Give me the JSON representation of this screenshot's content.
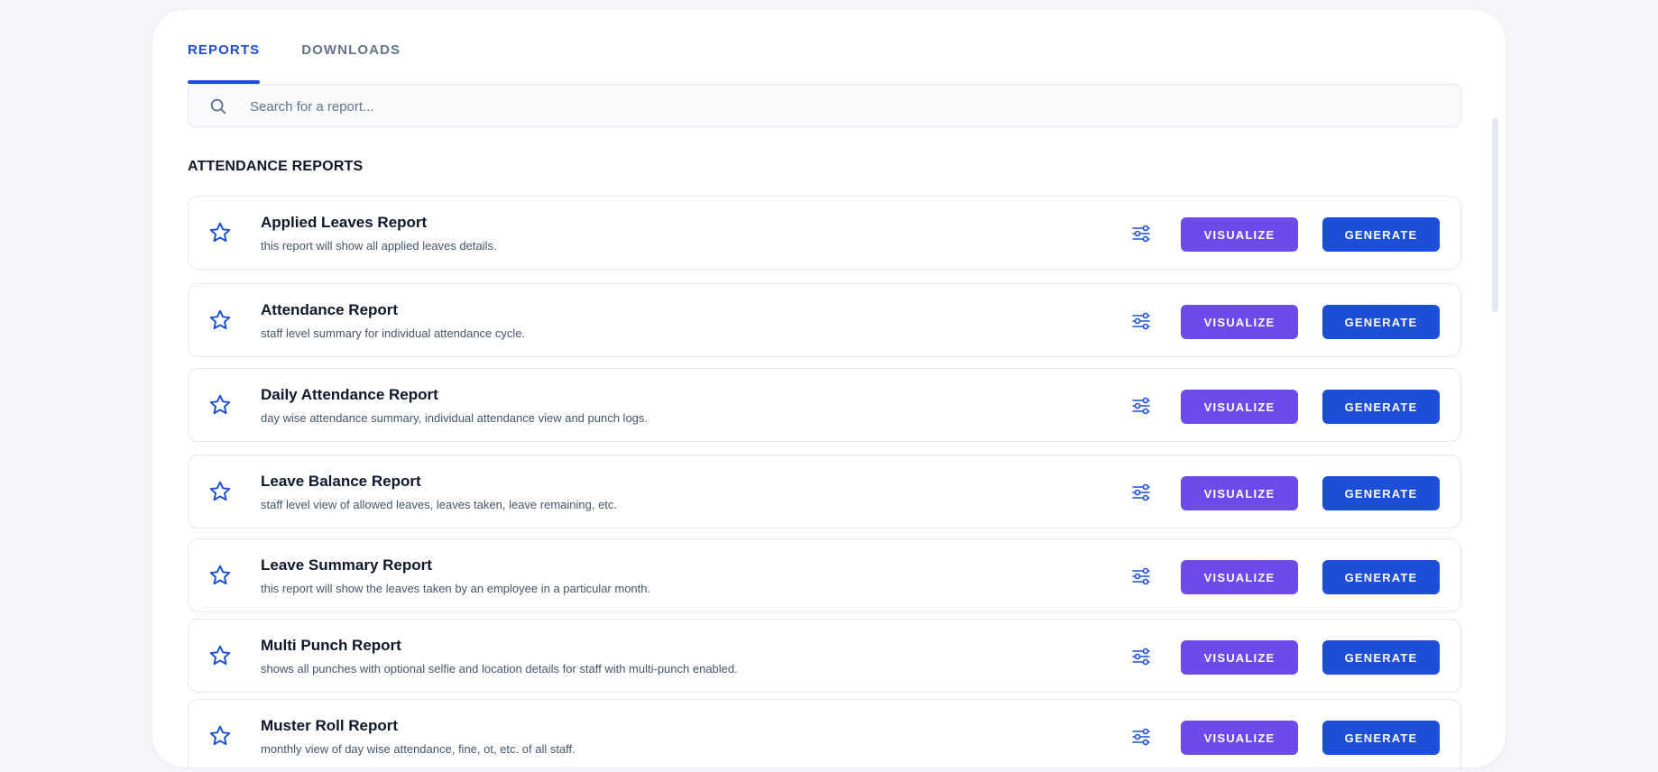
{
  "tabs": [
    {
      "label": "REPORTS",
      "active": true
    },
    {
      "label": "DOWNLOADS",
      "active": false
    }
  ],
  "search": {
    "placeholder": "Search for a report...",
    "value": ""
  },
  "section": {
    "title": "ATTENDANCE REPORTS"
  },
  "colors": {
    "accent": "#1d4ed8",
    "visualize": "#6d4aea",
    "generate": "#1d4ed8"
  },
  "reports": [
    {
      "title": "Applied Leaves Report",
      "description": "this report will show all applied leaves details.",
      "visualize_label": "VISUALIZE",
      "generate_label": "GENERATE"
    },
    {
      "title": "Attendance Report",
      "description": "staff level summary for individual attendance cycle.",
      "visualize_label": "VISUALIZE",
      "generate_label": "GENERATE"
    },
    {
      "title": "Daily Attendance Report",
      "description": "day wise attendance summary, individual attendance view and punch logs.",
      "visualize_label": "VISUALIZE",
      "generate_label": "GENERATE"
    },
    {
      "title": "Leave Balance Report",
      "description": "staff level view of allowed leaves, leaves taken, leave remaining, etc.",
      "visualize_label": "VISUALIZE",
      "generate_label": "GENERATE"
    },
    {
      "title": "Leave Summary Report",
      "description": "this report will show the leaves taken by an employee in a particular month.",
      "visualize_label": "VISUALIZE",
      "generate_label": "GENERATE"
    },
    {
      "title": "Multi Punch Report",
      "description": "shows all punches with optional selfie and location details for staff with multi-punch enabled.",
      "visualize_label": "VISUALIZE",
      "generate_label": "GENERATE"
    },
    {
      "title": "Muster Roll Report",
      "description": "monthly view of day wise attendance, fine, ot, etc. of all staff.",
      "visualize_label": "VISUALIZE",
      "generate_label": "GENERATE"
    }
  ],
  "icons": {
    "search": "search-icon",
    "favorite": "star-icon",
    "filter": "sliders-icon"
  }
}
